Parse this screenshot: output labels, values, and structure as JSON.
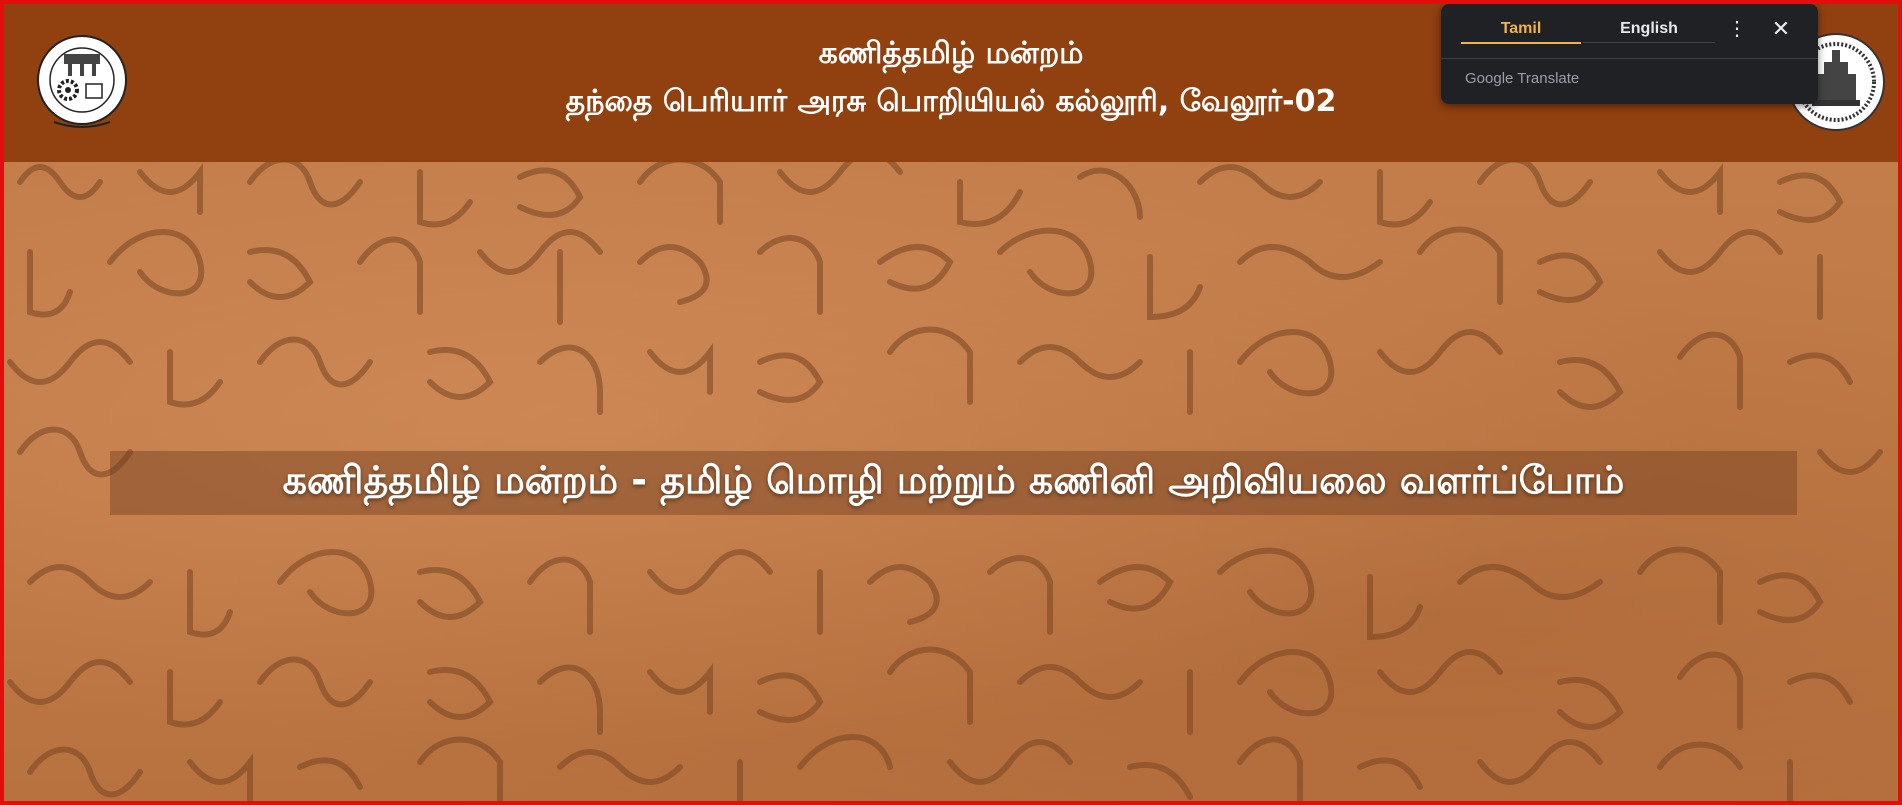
{
  "header": {
    "title": "கணித்தமிழ் மன்றம்",
    "subtitle": "தந்தை பெரியார் அரசு பொறியியல் கல்லூரி, வேலூர்-02",
    "left_logo_icon": "college-emblem-icon",
    "right_logo_icon": "government-seal-icon"
  },
  "hero": {
    "banner_text": "கணித்தமிழ் மன்றம் - தமிழ் மொழி மற்றும் கணினி அறிவியலை வளர்ப்போம்"
  },
  "translate_popup": {
    "tabs": [
      {
        "label": "Tamil",
        "active": true
      },
      {
        "label": "English",
        "active": false
      }
    ],
    "more_icon": "more-vert-icon",
    "close_icon": "close-icon",
    "brand_google": "Google",
    "brand_translate": "Translate"
  },
  "colors": {
    "header_bg": "#91400f",
    "frame_border": "#e10e0e",
    "active_tab": "#f2b24b",
    "popup_bg": "#202124"
  }
}
